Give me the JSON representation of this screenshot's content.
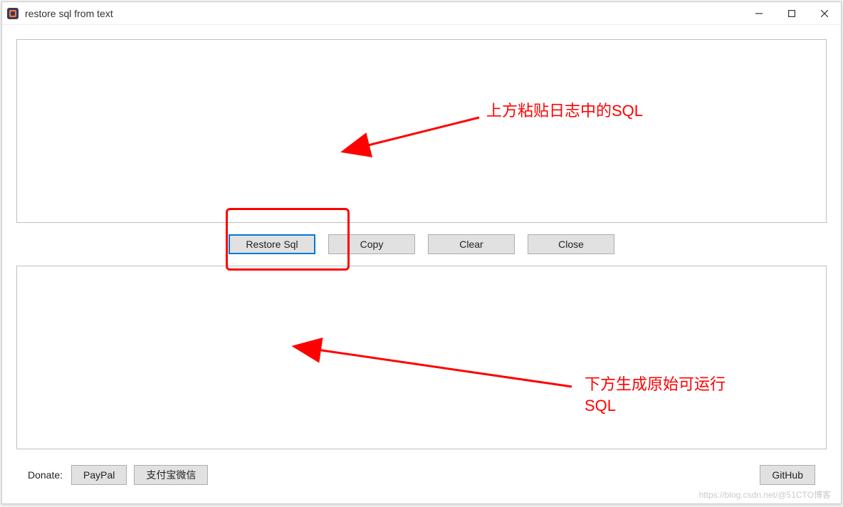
{
  "window": {
    "title": "restore sql from text"
  },
  "toolbar": {
    "restore_label": "Restore Sql",
    "copy_label": "Copy",
    "clear_label": "Clear",
    "close_label": "Close"
  },
  "panes": {
    "input_value": "",
    "output_value": ""
  },
  "footer": {
    "donate_label": "Donate:",
    "paypal_label": "PayPal",
    "alipay_wechat_label": "支付宝微信",
    "github_label": "GitHub"
  },
  "annotations": {
    "top_hint": "上方粘贴日志中的SQL",
    "bottom_hint_line1": "下方生成原始可运行",
    "bottom_hint_line2": "SQL"
  },
  "watermark": "https://blog.csdn.net/@51CTO博客"
}
